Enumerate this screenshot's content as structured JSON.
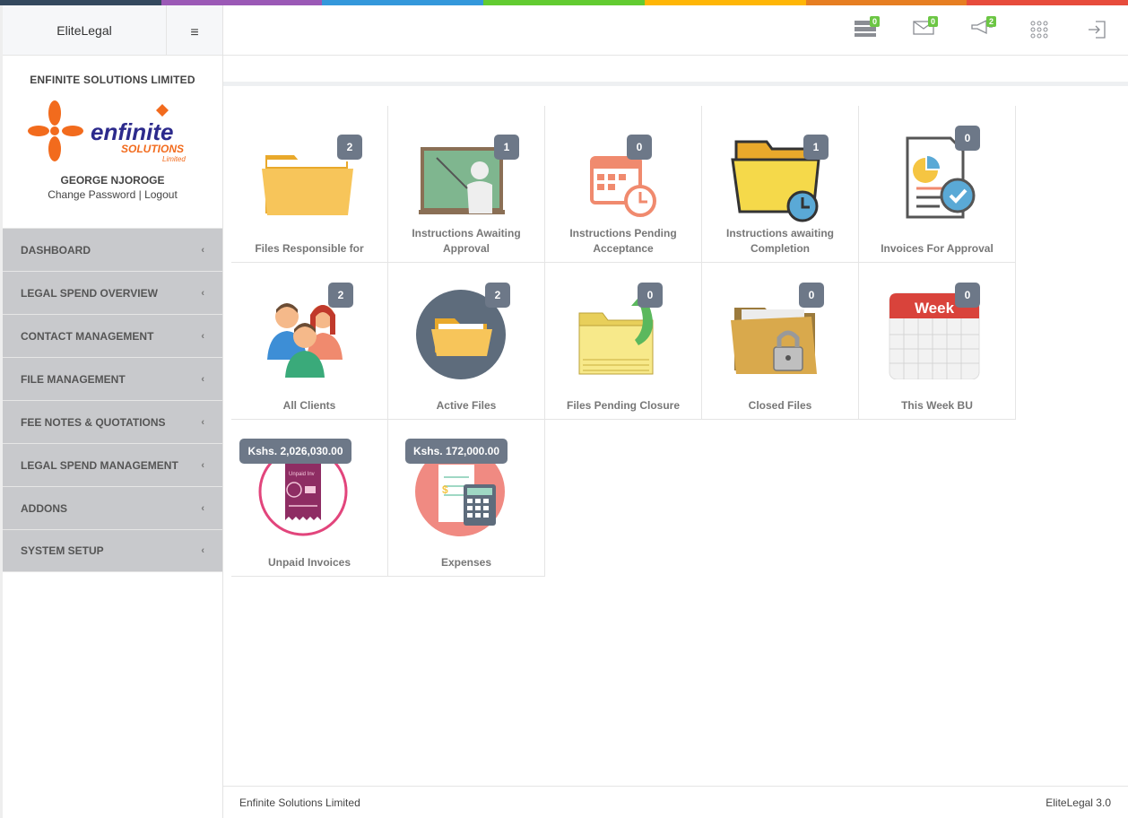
{
  "app": {
    "brand": "EliteLegal"
  },
  "profile": {
    "company": "ENFINITE SOLUTIONS LIMITED",
    "logo_text": "enfinite",
    "logo_sub": "SOLUTIONS",
    "logo_sub2": "Limited",
    "username": "GEORGE NJOROGE",
    "change_password": "Change Password",
    "separator": "|",
    "logout": "Logout"
  },
  "nav": [
    {
      "label": "DASHBOARD"
    },
    {
      "label": "LEGAL SPEND OVERVIEW"
    },
    {
      "label": "CONTACT MANAGEMENT"
    },
    {
      "label": "FILE MANAGEMENT"
    },
    {
      "label": "FEE NOTES & QUOTATIONS"
    },
    {
      "label": "LEGAL SPEND MANAGEMENT"
    },
    {
      "label": "ADDONS"
    },
    {
      "label": "SYSTEM SETUP"
    }
  ],
  "header": {
    "servers_badge": "0",
    "mail_badge": "0",
    "announce_badge": "2"
  },
  "tiles": [
    {
      "label": "Files Responsible for",
      "badge": "2",
      "icon": "folder-icon"
    },
    {
      "label": "Instructions Awaiting Approval",
      "badge": "1",
      "icon": "teacher-board-icon"
    },
    {
      "label": "Instructions Pending Acceptance",
      "badge": "0",
      "icon": "calendar-clock-icon"
    },
    {
      "label": "Instructions awaiting Completion",
      "badge": "1",
      "icon": "folder-clock-icon"
    },
    {
      "label": "Invoices For Approval",
      "badge": "0",
      "icon": "document-check-icon"
    },
    {
      "label": "All Clients",
      "badge": "2",
      "icon": "people-icon"
    },
    {
      "label": "Active Files",
      "badge": "2",
      "icon": "folder-circle-icon"
    },
    {
      "label": "Files Pending Closure",
      "badge": "0",
      "icon": "folder-arrow-icon"
    },
    {
      "label": "Closed Files",
      "badge": "0",
      "icon": "folder-lock-icon"
    },
    {
      "label": "This Week BU",
      "badge": "0",
      "icon": "week-calendar-icon",
      "week_text": "Week"
    },
    {
      "label": "Unpaid Invoices",
      "badge": "Kshs. 2,026,030.00",
      "icon": "unpaid-invoice-icon",
      "inv_text": "Unpaid Inv"
    },
    {
      "label": "Expenses",
      "badge": "Kshs. 172,000.00",
      "icon": "calculator-receipt-icon"
    }
  ],
  "footer": {
    "left": "Enfinite Solutions Limited",
    "right": "EliteLegal 3.0"
  },
  "colors": {
    "topbar": [
      "#34495e",
      "#9b59b6",
      "#3498db",
      "#62cb31",
      "#ffb606",
      "#e67e22",
      "#e74c3c"
    ],
    "badge": "#6d7888",
    "nav_bg": "#c8c9cc",
    "header_badge": "#6cc644"
  }
}
